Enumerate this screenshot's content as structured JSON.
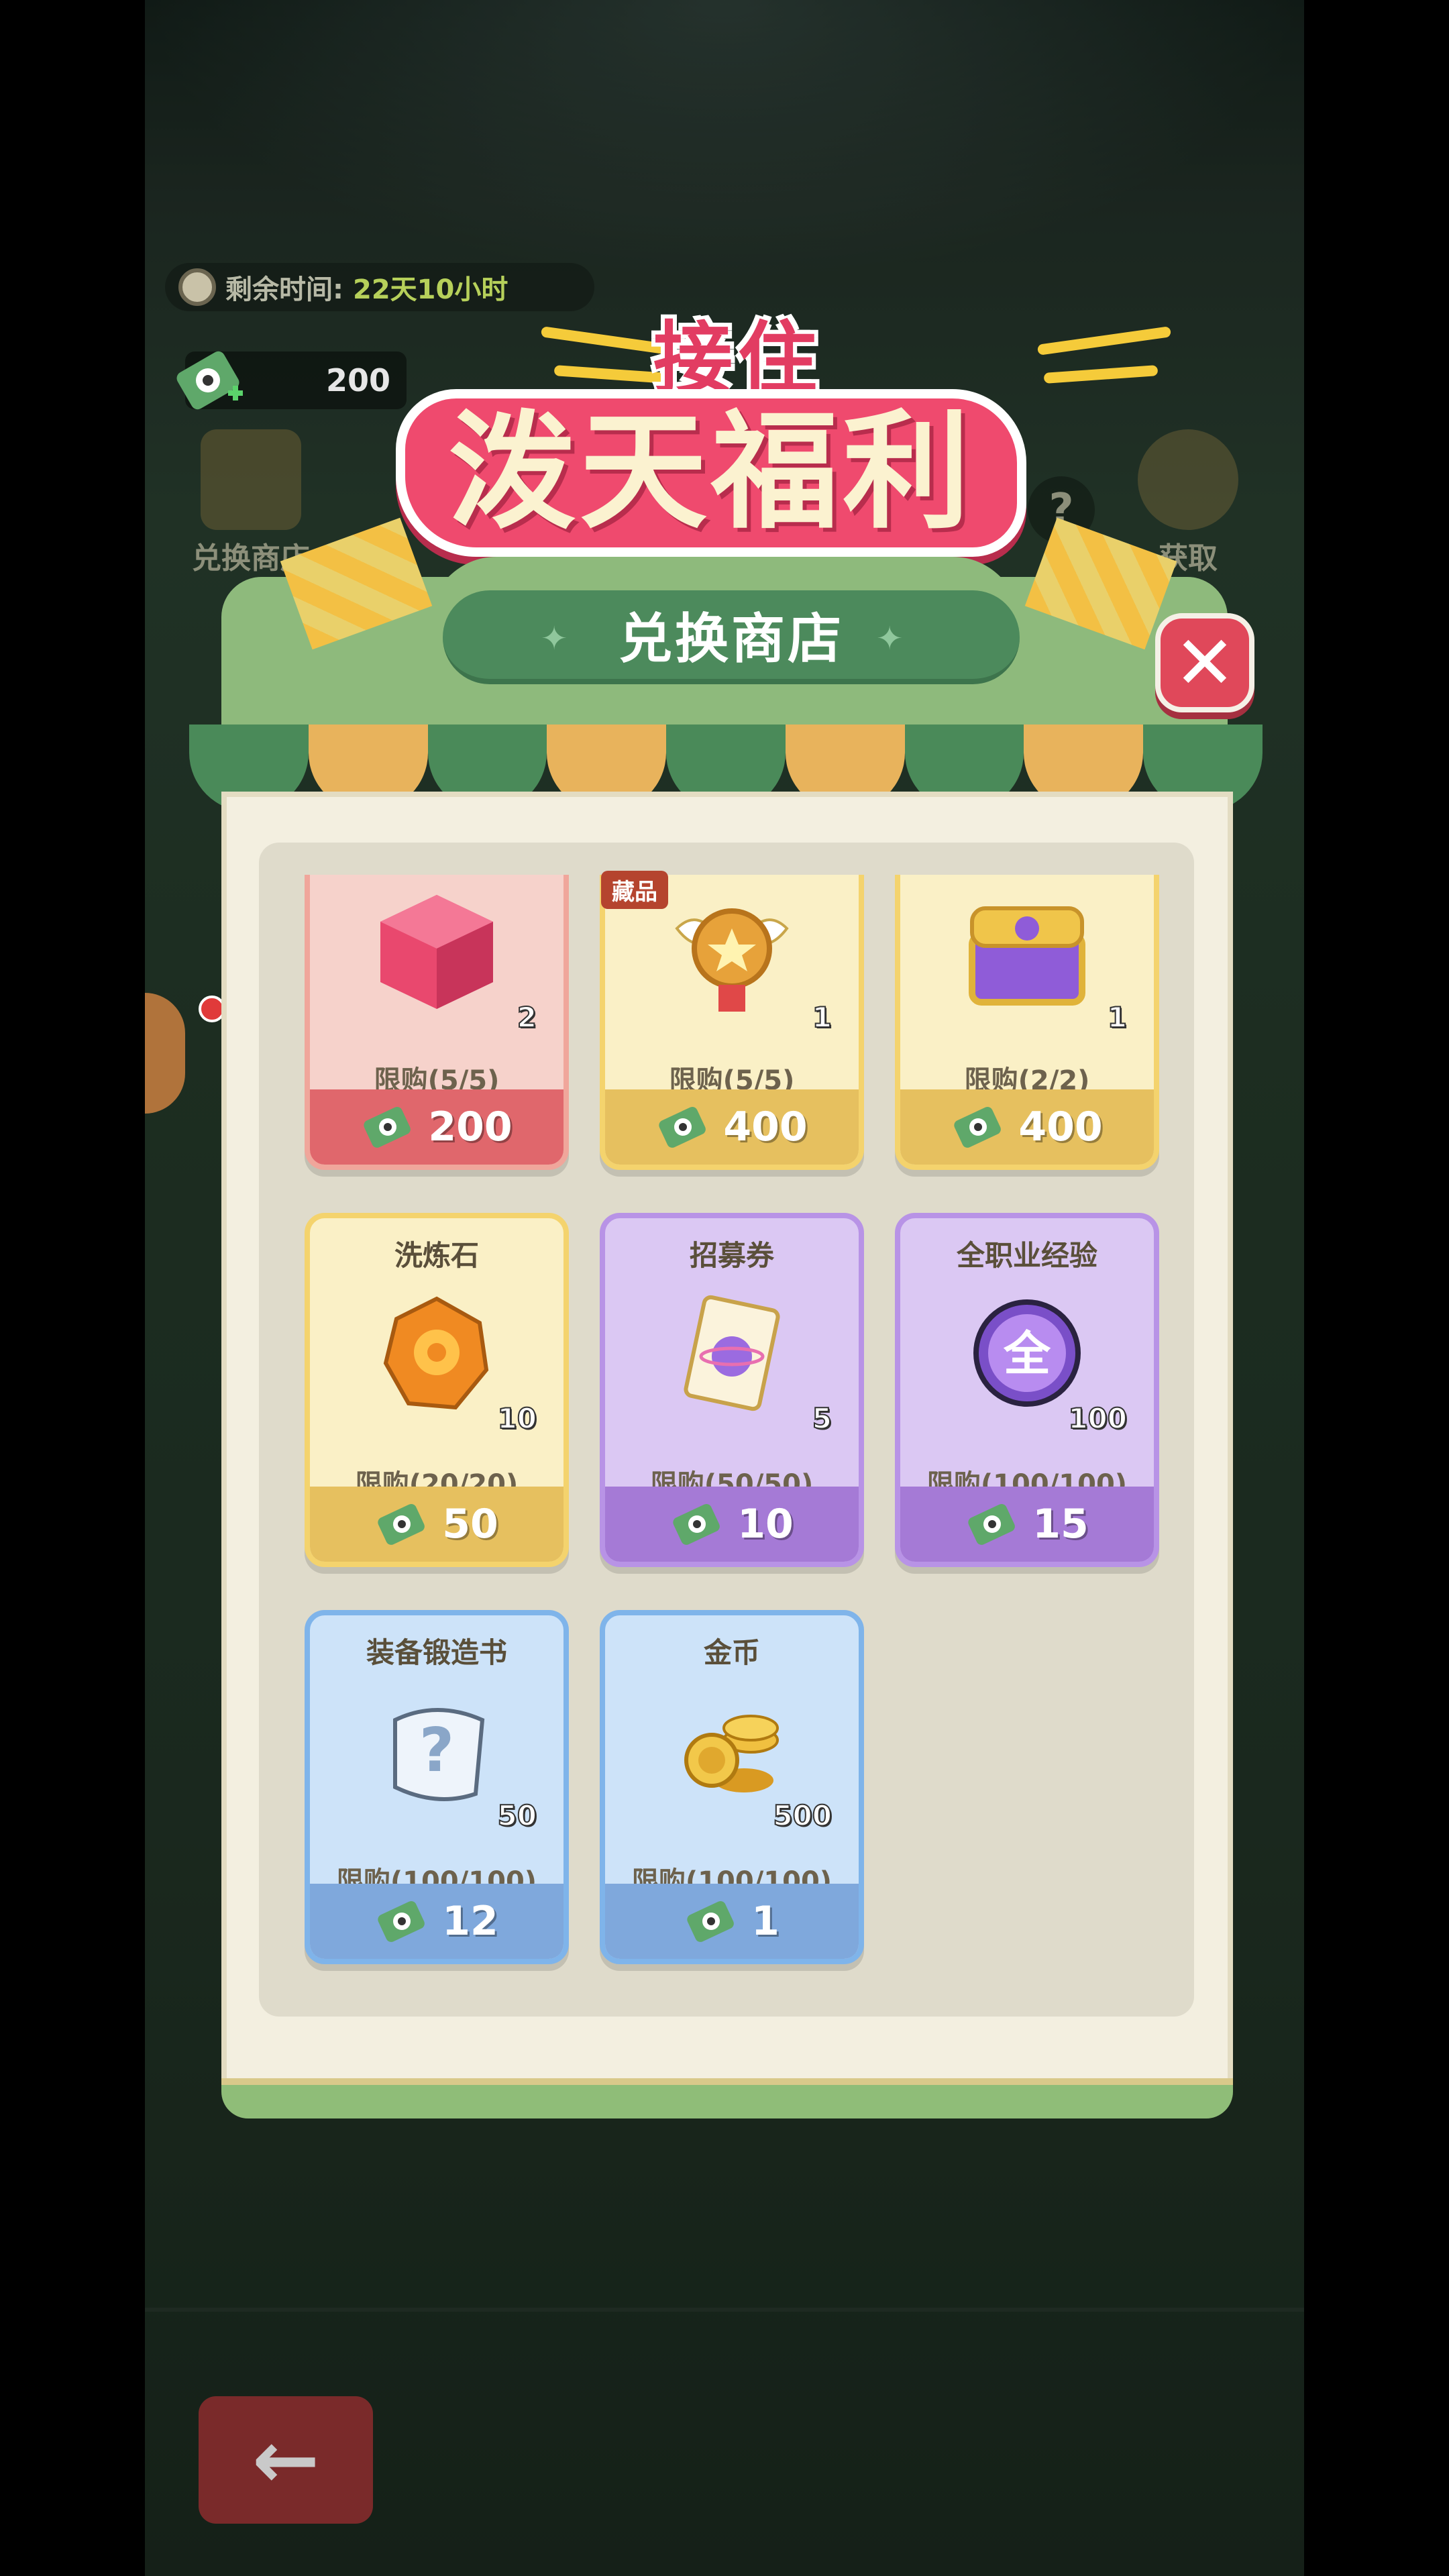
{
  "hud": {
    "timer_label": "剩余时间:",
    "timer_value": "22天10小时",
    "currency_value": "200"
  },
  "side_buttons": {
    "exchange_shop": "兑换商店",
    "obtain": "获取",
    "help": "?"
  },
  "banner": {
    "line1": "接住",
    "line2": "泼天福利"
  },
  "shop": {
    "title": "兑换商店",
    "close": "✕",
    "items": [
      {
        "name": "",
        "count": "2",
        "limit": "限购(5/5)",
        "price": "200",
        "theme": "red",
        "icon": "red-cube-icon"
      },
      {
        "name": "",
        "count": "1",
        "limit": "限购(5/5)",
        "price": "400",
        "theme": "yellow",
        "icon": "winged-medal-icon",
        "tag": "藏品"
      },
      {
        "name": "",
        "count": "1",
        "limit": "限购(2/2)",
        "price": "400",
        "theme": "yellow",
        "icon": "treasure-chest-icon"
      },
      {
        "name": "洗炼石",
        "count": "10",
        "limit": "限购(20/20)",
        "price": "50",
        "theme": "yellow",
        "icon": "refine-stone-icon"
      },
      {
        "name": "招募券",
        "count": "5",
        "limit": "限购(50/50)",
        "price": "10",
        "theme": "purple",
        "icon": "recruit-ticket-icon"
      },
      {
        "name": "全职业经验",
        "count": "100",
        "limit": "限购(100/100)",
        "price": "15",
        "theme": "purple",
        "icon": "exp-orb-icon"
      },
      {
        "name": "装备锻造书",
        "count": "50",
        "limit": "限购(100/100)",
        "price": "12",
        "theme": "blue",
        "icon": "forge-scroll-icon"
      },
      {
        "name": "金币",
        "count": "500",
        "limit": "限购(100/100)",
        "price": "1",
        "theme": "blue",
        "icon": "gold-coins-icon"
      }
    ]
  },
  "nav": {
    "back": "←"
  },
  "colors": {
    "red_card": "#f6d2cb",
    "yellow_card": "#faf0c6",
    "purple_card": "#dbc8f3",
    "blue_card": "#cde3f9",
    "title_bar": "#4c8a5c",
    "close": "#e0485a"
  }
}
